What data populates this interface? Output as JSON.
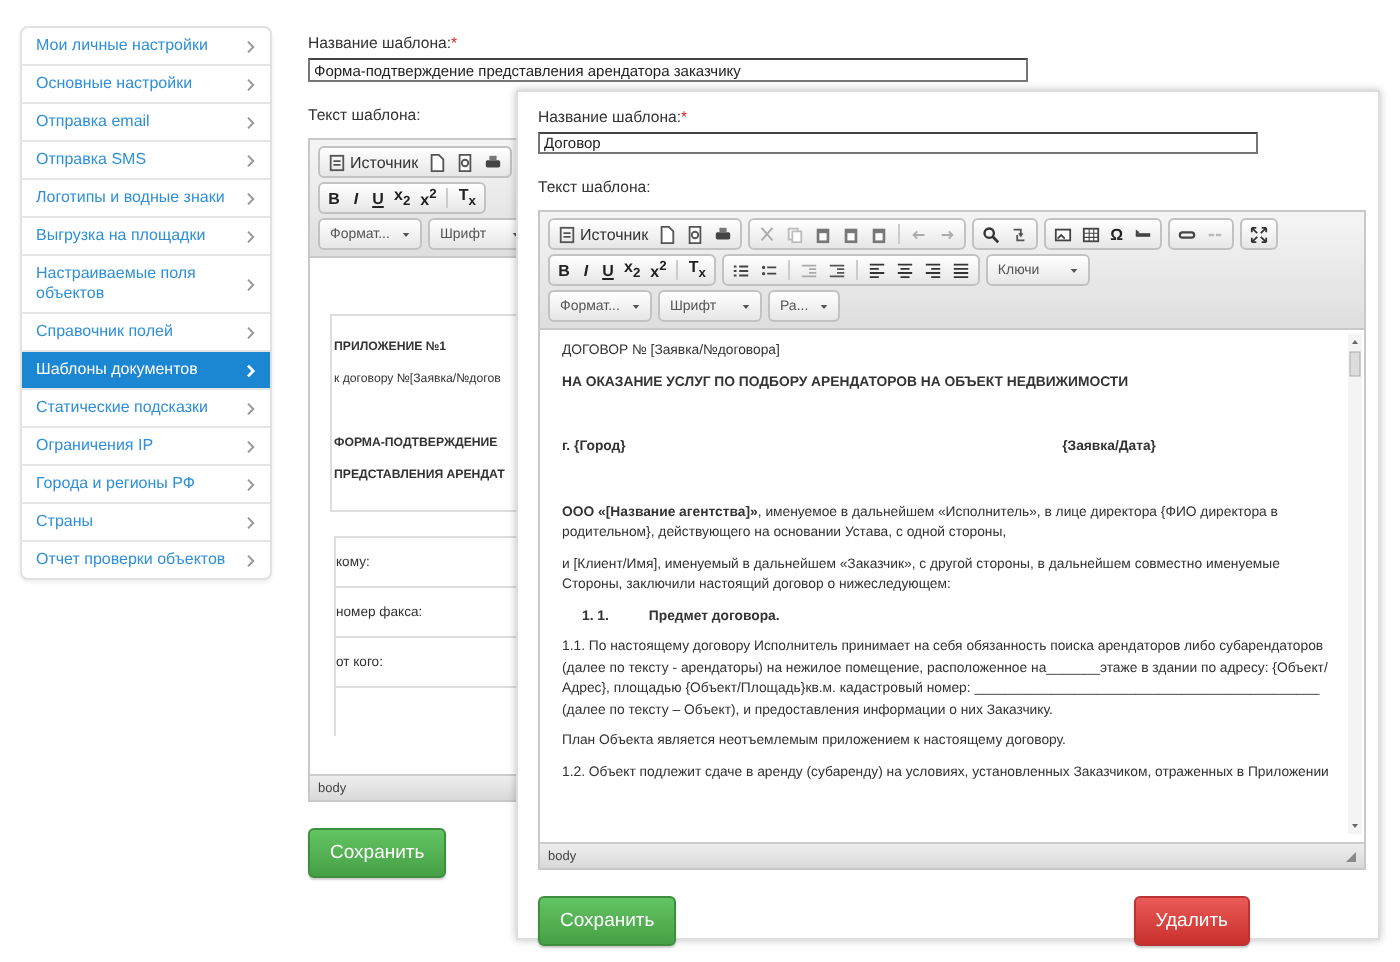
{
  "sidebar": {
    "items": [
      {
        "label": "Мои личные настройки",
        "selected": false
      },
      {
        "label": "Основные настройки",
        "selected": false
      },
      {
        "label": "Отправка email",
        "selected": false
      },
      {
        "label": "Отправка SMS",
        "selected": false
      },
      {
        "label": "Логотипы и водные знаки",
        "selected": false
      },
      {
        "label": "Выгрузка на площадки",
        "selected": false
      },
      {
        "label": "Настраиваемые поля объектов",
        "selected": false
      },
      {
        "label": "Справочник полей",
        "selected": false
      },
      {
        "label": "Шаблоны документов",
        "selected": true
      },
      {
        "label": "Статические подсказки",
        "selected": false
      },
      {
        "label": "Ограничения IP",
        "selected": false
      },
      {
        "label": "Города и регионы РФ",
        "selected": false
      },
      {
        "label": "Страны",
        "selected": false
      },
      {
        "label": "Отчет проверки объектов",
        "selected": false
      }
    ]
  },
  "template_form": {
    "name_label": "Название шаблона:",
    "required_mark": "*",
    "name_value": "Форма-подтверждение представления арендатора заказчику",
    "text_label": "Текст шаблона:",
    "editor": {
      "toolbar": {
        "source": "Источник",
        "format_buttons": [
          "B",
          "I",
          "U",
          "x$_{2}$",
          "x$^{2}$",
          "T$_{x}$"
        ],
        "style_dropdowns": [
          "Формат...",
          "Шрифт"
        ]
      },
      "blocks": [
        {
          "kind": "bold",
          "text": "ПРИЛОЖЕНИЕ №1"
        },
        {
          "kind": "plain",
          "text": "к договору №[Заявка/№догов"
        },
        {
          "kind": "bold",
          "text": "ФОРМА-ПОДТВЕРЖДЕНИЕ"
        },
        {
          "kind": "bold",
          "text": "ПРЕДСТАВЛЕНИЯ  АРЕНДАТ"
        }
      ],
      "table_rows": [
        "кому:",
        "номер факса:",
        "от кого:"
      ],
      "status": "body"
    },
    "save_button": "Сохранить"
  },
  "dialog": {
    "name_label": "Название шаблона:",
    "required_mark": "*",
    "name_value": "Договор",
    "text_label": "Текст шаблона:",
    "editor": {
      "toolbar": {
        "source": "Источник",
        "format_buttons": [
          "B",
          "I",
          "U",
          "x$_{2}$",
          "x$^{2}$",
          "T$_{x}$"
        ],
        "special_char": "Ω",
        "key_dropdown": "Ключи",
        "style_dropdowns": [
          "Формат...",
          "Шрифт",
          "Ра..."
        ]
      },
      "blocks": [
        {
          "kind": "plain",
          "text": "ДОГОВОР № [Заявка/№договора]"
        },
        {
          "kind": "bold",
          "text": "НА ОКАЗАНИЕ УСЛУГ ПО ПОДБОРУ АРЕНДАТОРОВ НА ОБЪЕКТ НЕДВИЖИМОСТИ"
        },
        {
          "kind": "date_row",
          "left": "г. {Город}",
          "right": "{Заявка/Дата}"
        },
        {
          "kind": "plain",
          "text": "**ООО «[Название агентства]»**, именуемое в дальнейшем «Исполнитель», в лице директора {ФИО директора в родительном}, действующего на основании Устава, с одной стороны,"
        },
        {
          "kind": "plain",
          "text": "и [Клиент/Имя], именуемый в дальнейшем «Заказчик», с другой стороны, в дальнейшем совместно именуемые Стороны, заключили настоящий договор о нижеследующем:"
        },
        {
          "kind": "section",
          "number": "1. 1.",
          "text": "Предмет договора."
        },
        {
          "kind": "plain",
          "text": "1.1. По настоящему договору Исполнитель принимает на себя обязанность поиска арендаторов либо субарендаторов (далее по тексту - арендаторы) на нежилое помещение, расположенное на_______этаже в здании по адресу: {Объект/Адрес}, площадью {Объект/Площадь}кв.м.  кадастровый номер: _____________________________________________ (далее по тексту – Объект), и предоставления информации о них Заказчику."
        },
        {
          "kind": "plain",
          "text": "План Объекта является неотъемлемым приложением к настоящему договору."
        },
        {
          "kind": "plain",
          "text": "1.2. Объект подлежит сдаче в аренду (субаренду) на условиях, установленных Заказчиком, отраженных в Приложении"
        }
      ],
      "status": "body"
    },
    "save_button": "Сохранить",
    "delete_button": "Удалить"
  }
}
